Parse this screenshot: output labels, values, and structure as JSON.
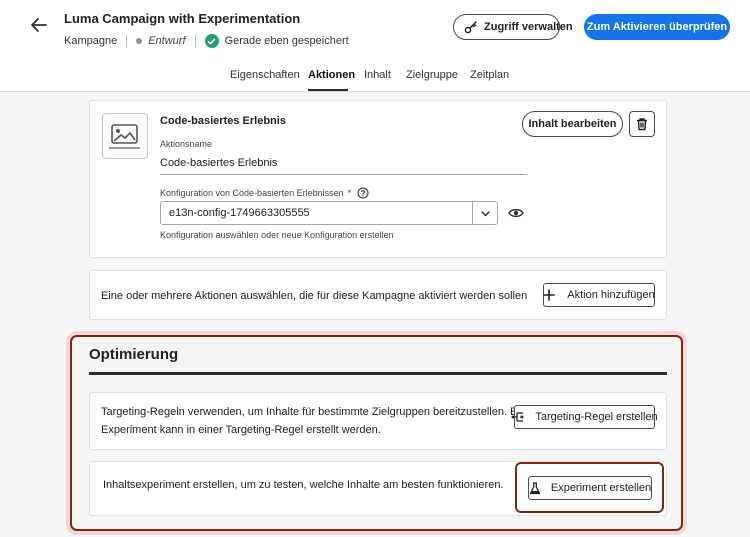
{
  "header": {
    "title": "Luma Campaign with Experimentation",
    "type": "Kampagne",
    "status": "Entwurf",
    "save_status": "Gerade eben gespeichert",
    "manage_access_label": "Zugriff verwalten",
    "review_activate_label": "Zum Aktivieren überprüfen"
  },
  "tabs": [
    {
      "label": "Eigenschaften",
      "active": false
    },
    {
      "label": "Aktionen",
      "active": true
    },
    {
      "label": "Inhalt",
      "active": false
    },
    {
      "label": "Zielgruppe",
      "active": false
    },
    {
      "label": "Zeitplan",
      "active": false
    }
  ],
  "action_card": {
    "title": "Code-basiertes Erlebnis",
    "edit_content_label": "Inhalt bearbeiten",
    "action_name_label": "Aktionsname",
    "action_name_value": "Code-basiertes Erlebnis",
    "config_label": "Konfiguration von Code-basierten Erlebnissen",
    "config_required": "*",
    "config_value": "e13n-config-1749663305555",
    "config_help": "Konfiguration auswählen oder neue Konfiguration erstellen"
  },
  "add_action": {
    "description": "Eine oder mehrere Aktionen auswählen, die für diese Kampagne aktiviert werden sollen",
    "button_label": "Aktion hinzufügen"
  },
  "optimization": {
    "title": "Optimierung",
    "targeting_text_line1": "Targeting-Regeln verwenden, um Inhalte für bestimmte Zielgruppen bereitzustellen. Ein",
    "targeting_text_line2": "Experiment kann in einer Targeting-Regel erstellt werden.",
    "targeting_button_label": "Targeting-Regel erstellen",
    "experiment_text": "Inhaltsexperiment erstellen, um zu testen, welche Inhalte am besten funktionieren.",
    "experiment_button_label": "Experiment erstellen"
  },
  "colors": {
    "accent": "#1473e6",
    "success": "#2d9d78",
    "highlight_border": "#7a2a0e",
    "highlight_glow": "#f8d3e0"
  }
}
